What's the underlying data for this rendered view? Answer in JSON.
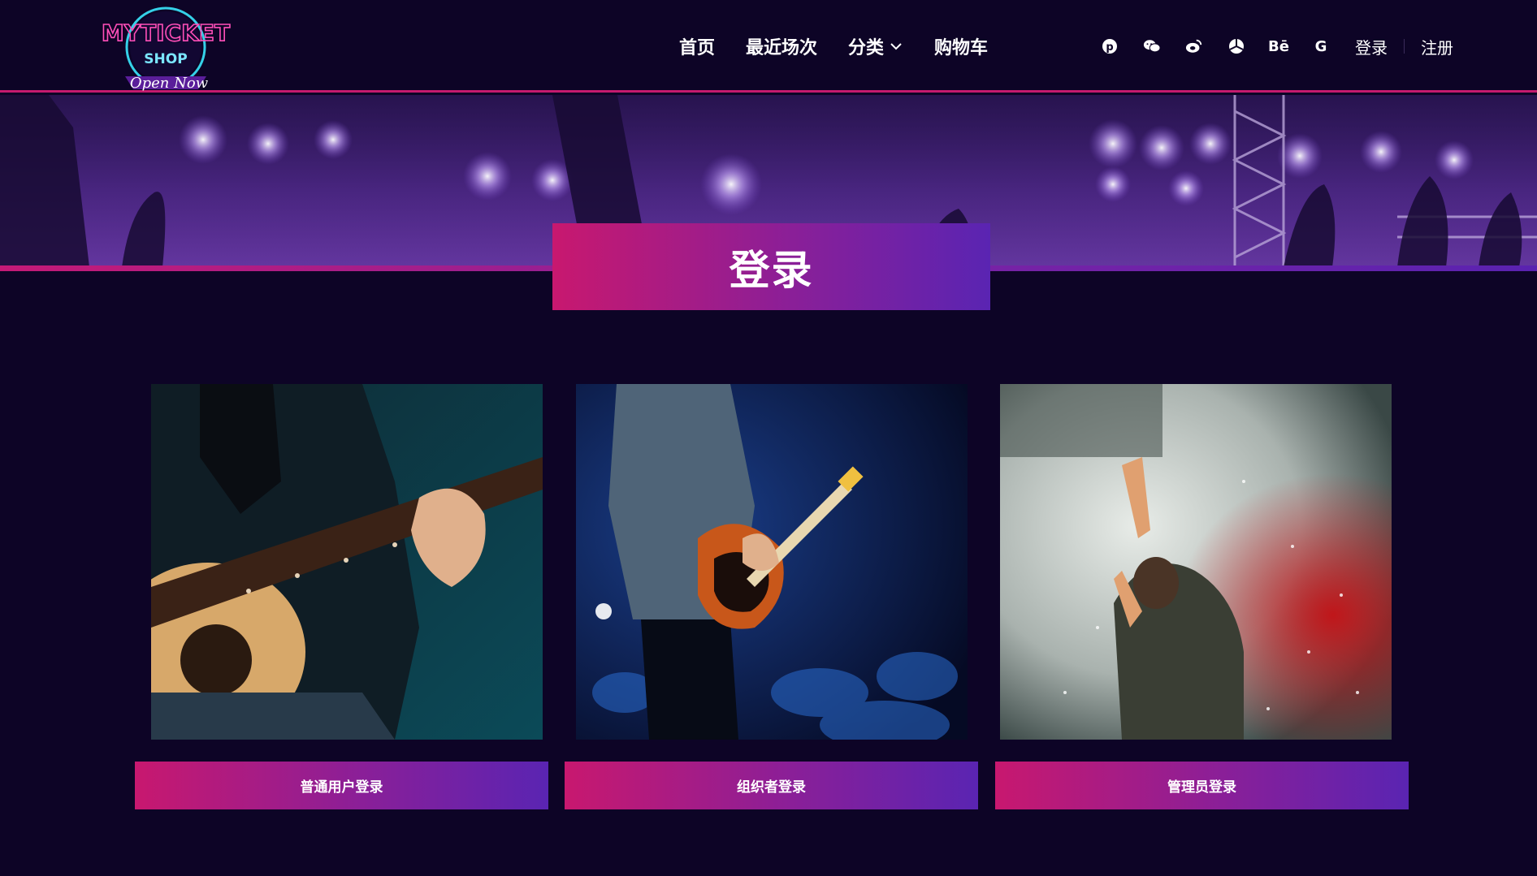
{
  "header": {
    "logo_text": "MYTICKET",
    "logo_sub": "SHOP",
    "logo_tagline": "Open Now",
    "nav": [
      {
        "label": "首页"
      },
      {
        "label": "最近场次"
      },
      {
        "label": "分类"
      },
      {
        "label": "购物车"
      }
    ],
    "social": [
      {
        "icon": "pinterest-icon"
      },
      {
        "icon": "wechat-icon"
      },
      {
        "icon": "weibo-icon"
      },
      {
        "icon": "aperture-icon"
      },
      {
        "icon": "behance-icon",
        "text": "Bē"
      },
      {
        "icon": "google-icon",
        "text": "G"
      }
    ],
    "login": "登录",
    "register": "注册"
  },
  "page_title": "登录",
  "cards": [
    {
      "button": "普通用户登录",
      "image": "acoustic-guitar-player"
    },
    {
      "button": "组织者登录",
      "image": "electric-guitar-on-stage"
    },
    {
      "button": "管理员登录",
      "image": "singer-in-smoke"
    }
  ],
  "colors": {
    "background": "#0d0426",
    "accent_pink": "#c8186f",
    "accent_purple": "#5a24b2"
  }
}
